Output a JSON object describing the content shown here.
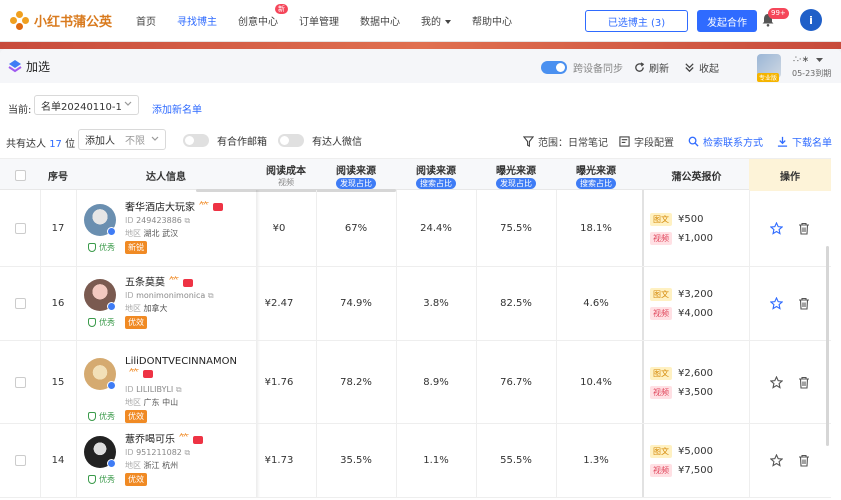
{
  "nav": {
    "logo_text": "小红书蒲公英",
    "items": [
      {
        "label": "首页",
        "active": false
      },
      {
        "label": "寻找博主",
        "active": true
      },
      {
        "label": "创意中心",
        "active": false,
        "badge": "新"
      },
      {
        "label": "订单管理",
        "active": false
      },
      {
        "label": "数据中心",
        "active": false
      },
      {
        "label": "我的",
        "active": false,
        "dropdown": true
      },
      {
        "label": "帮助中心",
        "active": false
      }
    ],
    "selected_bloggers_btn": "已选博主 (3)",
    "start_collab_btn": "发起合作",
    "notif_badge": "99+",
    "user_initial": "i"
  },
  "panel": {
    "title": "加选",
    "sync_label": "跨设备同步",
    "refresh_label": "刷新",
    "collapse_label": "收起",
    "account_name": "∴·∗",
    "account_tag": "专业版",
    "account_expiry": "05-23到期"
  },
  "toolbar": {
    "current_label": "当前:",
    "list_name": "名单20240110-1",
    "add_list": "添加新名单",
    "total_prefix": "共有达人",
    "total_count": "17",
    "total_suffix": "位",
    "add_creator": "添加人",
    "add_creator_limit": "不限",
    "filter_mailbox": "有合作邮箱",
    "filter_wechat": "有达人微信",
    "scope": "范围：日常笔记",
    "field_config": "字段配置",
    "search_contact": "检索联系方式",
    "download_list": "下载名单"
  },
  "table": {
    "headers": {
      "index": "序号",
      "creator": "达人信息",
      "read_cost": "阅读成本",
      "read_cost_sub": "视频",
      "read_src1": "阅读来源",
      "read_src1_pill": "发现占比",
      "read_src2": "阅读来源",
      "read_src2_pill": "搜索占比",
      "exp_src1": "曝光来源",
      "exp_src1_pill": "发现占比",
      "exp_src2": "曝光来源",
      "exp_src2_pill": "搜索占比",
      "price": "蒲公英报价",
      "ops": "操作"
    },
    "labels": {
      "id": "ID",
      "region": "地区",
      "quality": "优秀",
      "img_tag": "图文",
      "vid_tag": "视频"
    },
    "rows": [
      {
        "index": "17",
        "name": "奢华酒店大玩家",
        "id": "249423886",
        "region": "湖北 武汉",
        "tag": "新锐",
        "read_cost": "¥0",
        "read_find": "67%",
        "read_search": "24.4%",
        "exp_find": "75.5%",
        "exp_search": "18.1%",
        "price_img": "¥500",
        "price_vid": "¥1,000",
        "starred": true
      },
      {
        "index": "16",
        "name": "五条莫莫",
        "id": "monimonimonica",
        "region": "加拿大",
        "tag": "优效",
        "read_cost": "¥2.47",
        "read_find": "74.9%",
        "read_search": "3.8%",
        "exp_find": "82.5%",
        "exp_search": "4.6%",
        "price_img": "¥3,200",
        "price_vid": "¥4,000",
        "starred": true
      },
      {
        "index": "15",
        "name": "LiliDONTVECINNAMON",
        "id": "LILILIBYLI",
        "region": "广东 中山",
        "tag": "优效",
        "read_cost": "¥1.76",
        "read_find": "78.2%",
        "read_search": "8.9%",
        "exp_find": "76.7%",
        "exp_search": "10.4%",
        "price_img": "¥2,600",
        "price_vid": "¥3,500",
        "starred": false
      },
      {
        "index": "14",
        "name": "薏乔喝可乐",
        "id": "951211082",
        "region": "浙江 杭州",
        "tag": "优效",
        "read_cost": "¥1.73",
        "read_find": "35.5%",
        "read_search": "1.1%",
        "exp_find": "55.5%",
        "exp_search": "1.3%",
        "price_img": "¥5,000",
        "price_vid": "¥7,500",
        "starred": false
      }
    ]
  }
}
